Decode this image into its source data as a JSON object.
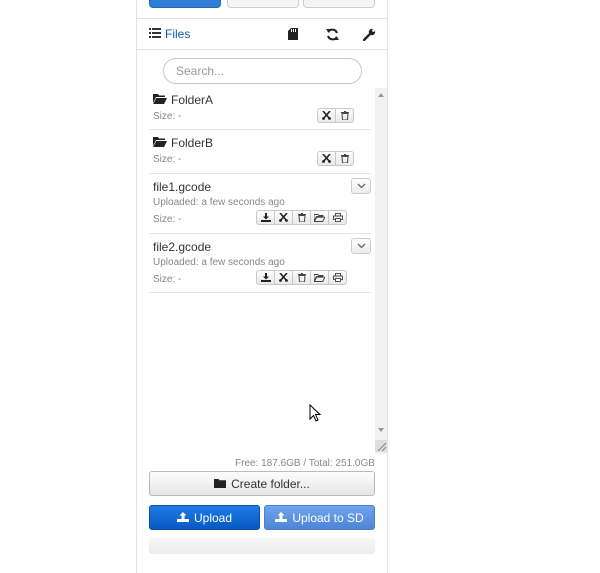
{
  "header": {
    "files_label": "Files",
    "icons": [
      "list-icon",
      "sd-card-icon",
      "refresh-icon",
      "wrench-icon"
    ]
  },
  "search": {
    "placeholder": "Search..."
  },
  "files": [
    {
      "type": "folder",
      "name": "FolderA",
      "size": "Size: -",
      "actions": [
        "cut-icon",
        "trash-icon"
      ]
    },
    {
      "type": "folder",
      "name": "FolderB",
      "size": "Size: -",
      "actions": [
        "cut-icon",
        "trash-icon"
      ]
    },
    {
      "type": "file",
      "name": "file1.gcode",
      "uploaded": "Uploaded: a few seconds ago",
      "size": "Size: -",
      "actions": [
        "download-icon",
        "cut-icon",
        "trash-icon",
        "folder-open-icon",
        "print-icon"
      ]
    },
    {
      "type": "file",
      "name": "file2.gcode",
      "uploaded": "Uploaded: a few seconds ago",
      "size": "Size: -",
      "actions": [
        "download-icon",
        "cut-icon",
        "trash-icon",
        "folder-open-icon",
        "print-icon"
      ]
    }
  ],
  "storage": {
    "text": "Free: 187.6GB / Total: 251.0GB"
  },
  "buttons": {
    "create_folder": "Create folder...",
    "upload": "Upload",
    "upload_sd": "Upload to SD"
  },
  "colors": {
    "accent": "#0a5aa8",
    "upload_primary": "#0759c4",
    "upload_secondary": "#5b8fdf"
  }
}
